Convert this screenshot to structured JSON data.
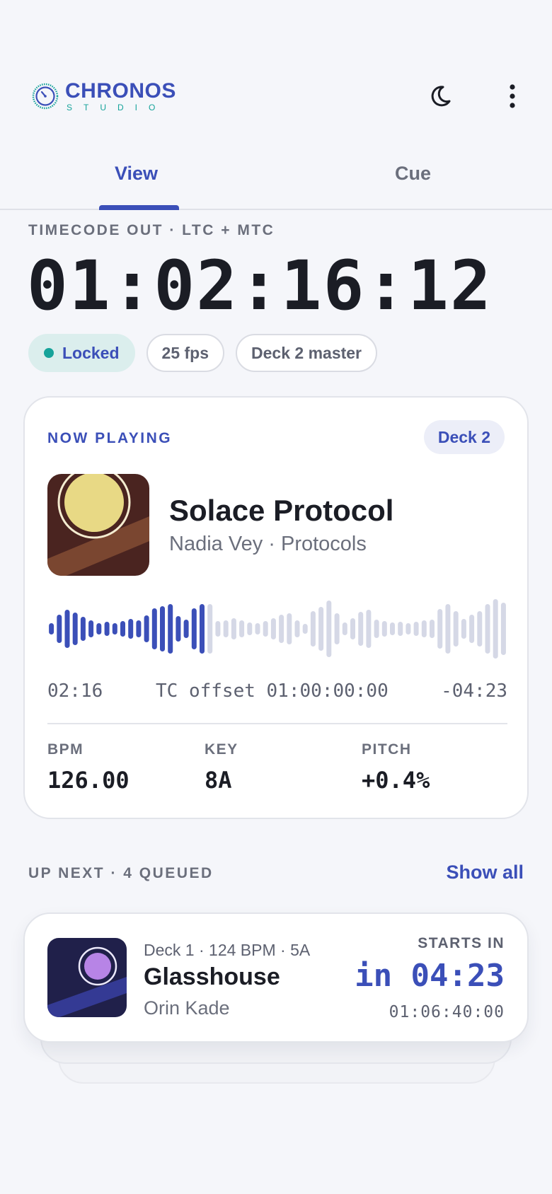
{
  "app": {
    "name": "CHRONOS",
    "sub": "STUDIO"
  },
  "header": {
    "theme_icon": "moon-icon",
    "menu_icon": "kebab-menu-icon"
  },
  "tabs": [
    {
      "label": "View",
      "active": true
    },
    {
      "label": "Cue",
      "active": false
    }
  ],
  "timecode": {
    "label": "TIMECODE OUT · LTC + MTC",
    "value": "01:02:16:12",
    "chips": [
      "Locked",
      "25 fps",
      "Deck 2 master"
    ]
  },
  "now_playing": {
    "label": "NOW PLAYING",
    "deck": "Deck 2",
    "title": "Solace Protocol",
    "artist": "Nadia Vey · Protocols",
    "elapsed": "02:16",
    "offset": "TC offset 01:00:00:00",
    "remaining": "-04:23",
    "progress": 0.34,
    "stats": [
      {
        "label": "BPM",
        "value": "126.00"
      },
      {
        "label": "KEY",
        "value": "8A"
      },
      {
        "label": "PITCH",
        "value": "+0.4%"
      }
    ]
  },
  "up_next": {
    "label": "UP NEXT · 4 QUEUED",
    "show_all": "Show all",
    "item": {
      "meta": "Deck 1 · 124 BPM · 5A",
      "title": "Glasshouse",
      "artist": "Orin Kade",
      "starts_label": "STARTS IN",
      "starts_in": "in 04:23",
      "timecode": "01:06:40:00"
    }
  },
  "colors": {
    "accent": "#3b4fb8",
    "teal": "#16a39a",
    "wave_played": "#3b4fb8",
    "wave_remaining": "#d5d8e6"
  }
}
